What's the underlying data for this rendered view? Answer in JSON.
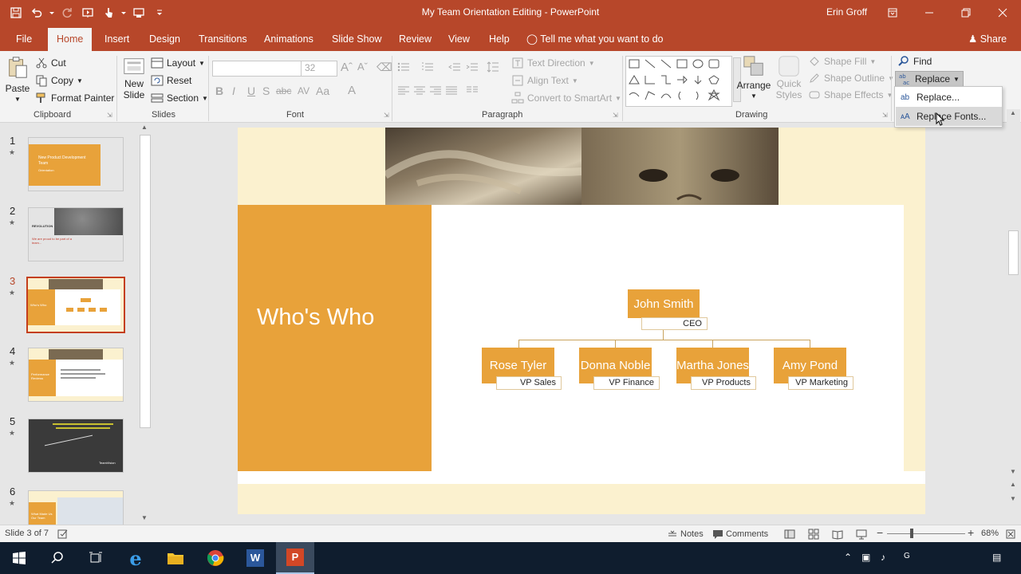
{
  "window": {
    "title": "My Team Orientation Editing  -  PowerPoint",
    "user": "Erin Groff"
  },
  "quick_access": [
    "save-icon",
    "undo-icon",
    "redo-icon",
    "start-from-beginning-icon",
    "touch-mode-icon",
    "present-icon",
    "customize-icon"
  ],
  "tabs": {
    "file": "File",
    "home": "Home",
    "insert": "Insert",
    "design": "Design",
    "transitions": "Transitions",
    "animations": "Animations",
    "slide_show": "Slide Show",
    "review": "Review",
    "view": "View",
    "help": "Help",
    "tell_me": "Tell me what you want to do",
    "share": "Share"
  },
  "ribbon": {
    "clipboard": {
      "label": "Clipboard",
      "paste": "Paste",
      "cut": "Cut",
      "copy": "Copy",
      "format_painter": "Format Painter"
    },
    "slides": {
      "label": "Slides",
      "new_slide_1": "New",
      "new_slide_2": "Slide",
      "layout": "Layout",
      "reset": "Reset",
      "section": "Section"
    },
    "font": {
      "label": "Font",
      "name": "",
      "size": "32"
    },
    "paragraph": {
      "label": "Paragraph",
      "text_direction": "Text Direction",
      "align_text": "Align Text",
      "convert_smartart": "Convert to SmartArt"
    },
    "drawing": {
      "label": "Drawing",
      "arrange": "Arrange",
      "quick_styles_1": "Quick",
      "quick_styles_2": "Styles",
      "shape_fill": "Shape Fill",
      "shape_outline": "Shape Outline",
      "shape_effects": "Shape Effects"
    },
    "editing": {
      "find": "Find",
      "replace": "Replace"
    }
  },
  "replace_menu": {
    "items": [
      "Replace...",
      "Replace Fonts..."
    ],
    "hover_index": 1
  },
  "thumbnails": [
    {
      "num": "1",
      "text": "New Product Development Team",
      "sub": "Orientation"
    },
    {
      "num": "2",
      "text": "We are proud to be part of a team...",
      "brand": "REVOLUTION"
    },
    {
      "num": "3",
      "text": "Who's Who"
    },
    {
      "num": "4",
      "text": "Performance Reviews"
    },
    {
      "num": "5",
      "text": "TeamVision"
    },
    {
      "num": "6",
      "text": "What Made Us Our Team"
    }
  ],
  "slide": {
    "title": "Who's Who",
    "org": {
      "top": {
        "name": "John Smith",
        "role": "CEO"
      },
      "reports": [
        {
          "name": "Rose Tyler",
          "role": "VP Sales"
        },
        {
          "name": "Donna Noble",
          "role": "VP Finance"
        },
        {
          "name": "Martha Jones",
          "role": "VP Products"
        },
        {
          "name": "Amy Pond",
          "role": "VP Marketing"
        }
      ]
    }
  },
  "status": {
    "slide_info": "Slide 3 of 7",
    "notes": "Notes",
    "comments": "Comments",
    "zoom": "68%"
  },
  "colors": {
    "accent": "#b7472a",
    "slide_orange": "#e8a23a",
    "slide_cream": "#fbf1cf"
  }
}
